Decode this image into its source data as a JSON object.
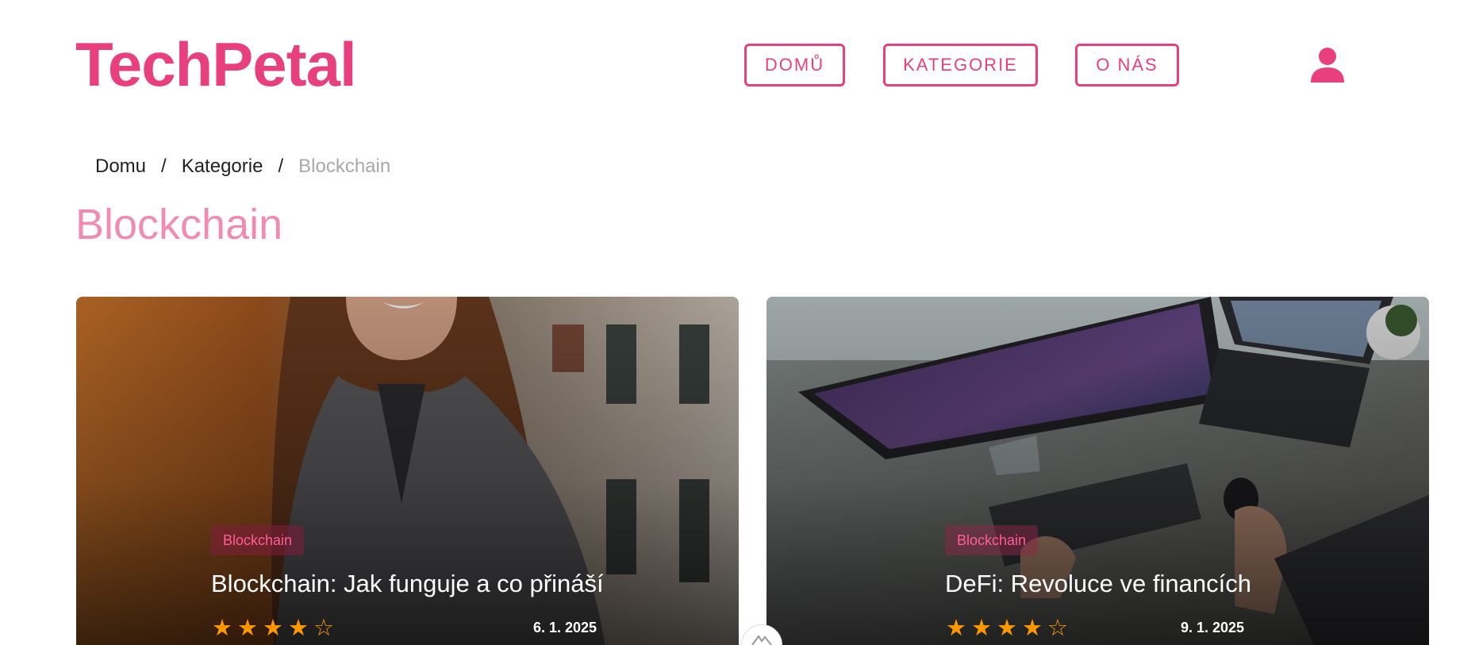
{
  "header": {
    "logo": "TechPetal",
    "nav": {
      "home": "DOMŮ",
      "categories": "KATEGORIE",
      "about": "O NÁS"
    },
    "user_icon": "user-icon"
  },
  "breadcrumb": {
    "items": [
      "Domu",
      "Kategorie",
      "Blockchain"
    ],
    "separator": "/"
  },
  "page": {
    "title": "Blockchain"
  },
  "cards": [
    {
      "badge": "Blockchain",
      "title": "Blockchain: Jak funguje a co přináší",
      "rating": 4,
      "rating_max": 5,
      "date": "6. 1. 2025"
    },
    {
      "badge": "Blockchain",
      "title": "DeFi: Revoluce ve financích",
      "rating": 4,
      "rating_max": 5,
      "date": "9. 1. 2025"
    }
  ],
  "colors": {
    "accent": "#e8407f",
    "title_pink": "#f08cb4",
    "star": "#ff9800"
  }
}
